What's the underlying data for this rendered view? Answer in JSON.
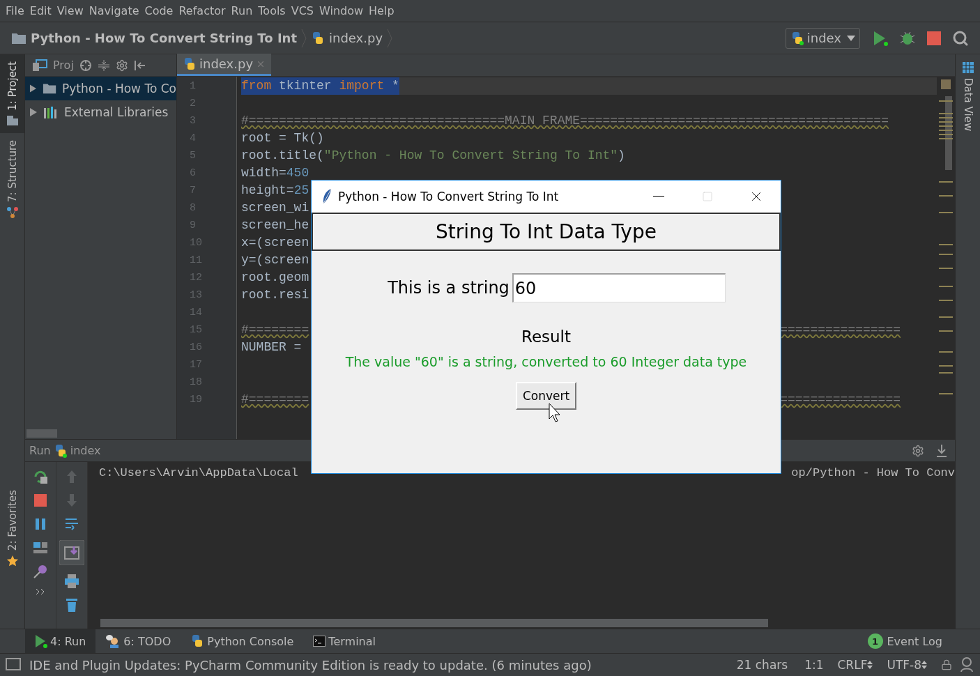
{
  "menu": [
    {
      "label": "File"
    },
    {
      "label": "Edit"
    },
    {
      "label": "View"
    },
    {
      "label": "Navigate"
    },
    {
      "label": "Code"
    },
    {
      "label": "Refactor"
    },
    {
      "label": "Run"
    },
    {
      "label": "Tools"
    },
    {
      "label": "VCS"
    },
    {
      "label": "Window"
    },
    {
      "label": "Help"
    }
  ],
  "breadcrumbs": [
    {
      "label": "Python - How To Convert String To Int",
      "kind": "folder"
    },
    {
      "label": "index.py",
      "kind": "file"
    }
  ],
  "run_config": "index",
  "left_strip": [
    {
      "label": "1: Project",
      "selected": true,
      "kind": "project"
    },
    {
      "label": "7: Structure",
      "selected": false,
      "kind": "structure"
    }
  ],
  "left_strip_bottom": [
    {
      "label": "2: Favorites",
      "selected": false,
      "kind": "favorites"
    }
  ],
  "project_view": {
    "label": "Proj"
  },
  "tree": [
    {
      "label": "Python - How To Co",
      "selected": true,
      "kind": "folder"
    },
    {
      "label": "External Libraries",
      "selected": false,
      "kind": "library"
    }
  ],
  "editor_tab": {
    "label": "index.py"
  },
  "code_lines": [
    {
      "number": "1",
      "selected": true,
      "segments": [
        {
          "text": "from",
          "kind": "keyword"
        },
        {
          "text": " tkinter ",
          "kind": "plain"
        },
        {
          "text": "import",
          "kind": "keyword"
        },
        {
          "text": " *",
          "kind": "plain"
        }
      ]
    },
    {
      "number": "2",
      "selected": false
    },
    {
      "number": "3",
      "selected": false,
      "segments": [
        {
          "text": "#==================================MAIN FRAME=========================================",
          "kind": "comment"
        }
      ]
    },
    {
      "number": "4",
      "selected": false,
      "segments": [
        {
          "text": "root = Tk()",
          "kind": "plain"
        }
      ]
    },
    {
      "number": "5",
      "selected": false,
      "segments": [
        {
          "text": "root.title(",
          "kind": "plain"
        },
        {
          "text": "\"Python - How To Convert String To Int\"",
          "kind": "string"
        },
        {
          "text": ")",
          "kind": "plain"
        }
      ]
    },
    {
      "number": "6",
      "selected": false,
      "segments": [
        {
          "text": "width=",
          "kind": "plain"
        },
        {
          "text": "450",
          "kind": "number"
        }
      ]
    },
    {
      "number": "7",
      "selected": false,
      "segments": [
        {
          "text": "height=",
          "kind": "plain"
        },
        {
          "text": "25",
          "kind": "number"
        }
      ]
    },
    {
      "number": "8",
      "selected": false,
      "segments": [
        {
          "text": "screen_wi",
          "kind": "plain"
        }
      ]
    },
    {
      "number": "9",
      "selected": false,
      "segments": [
        {
          "text": "screen_he",
          "kind": "plain"
        }
      ]
    },
    {
      "number": "10",
      "selected": false,
      "segments": [
        {
          "text": "x=(screen",
          "kind": "plain"
        }
      ]
    },
    {
      "number": "11",
      "selected": false,
      "segments": [
        {
          "text": "y=(screen",
          "kind": "plain"
        }
      ]
    },
    {
      "number": "12",
      "selected": false,
      "segments": [
        {
          "text": "root.geom",
          "kind": "plain"
        }
      ]
    },
    {
      "number": "13",
      "selected": false,
      "segments": [
        {
          "text": "root.resi",
          "kind": "plain"
        }
      ]
    },
    {
      "number": "14",
      "selected": false
    },
    {
      "number": "15",
      "selected": false,
      "segments": [
        {
          "text": "#========",
          "kind": "comment"
        }
      ],
      "tail": "================"
    },
    {
      "number": "16",
      "selected": false,
      "segments": [
        {
          "text": "NUMBER = ",
          "kind": "plain"
        }
      ]
    },
    {
      "number": "17",
      "selected": false
    },
    {
      "number": "18",
      "selected": false
    },
    {
      "number": "19",
      "selected": false,
      "segments": [
        {
          "text": "#========",
          "kind": "comment"
        }
      ],
      "tail": "================"
    }
  ],
  "right_strip": {
    "label": "Data View"
  },
  "run_panel": {
    "title": "Run",
    "config": "index",
    "console_start": "C:\\Users\\Arvin\\AppData\\Local",
    "console_end": "op/Python - How To Conv"
  },
  "bottom_tabs": [
    {
      "label": "4: Run",
      "selected": true,
      "kind": "run"
    },
    {
      "label": "6: TODO",
      "selected": false,
      "kind": "todo"
    },
    {
      "label": "Python Console",
      "selected": false,
      "kind": "console"
    },
    {
      "label": "Terminal",
      "selected": false,
      "kind": "terminal"
    }
  ],
  "event_log": {
    "count": "1",
    "label": "Event Log"
  },
  "status": {
    "message": "IDE and Plugin Updates: PyCharm Community Edition is ready to update. (6 minutes ago)",
    "chars": "21 chars",
    "position": "1:1",
    "line_sep": "CRLF",
    "encoding": "UTF-8"
  },
  "dialog": {
    "title": "Python - How To Convert String To Int",
    "heading": "String To Int Data Type",
    "field_label": "This is a string",
    "field_value": "60",
    "result_label": "Result",
    "result_text": "The value \"60\" is a string, converted to 60 Integer data type",
    "button": "Convert"
  }
}
